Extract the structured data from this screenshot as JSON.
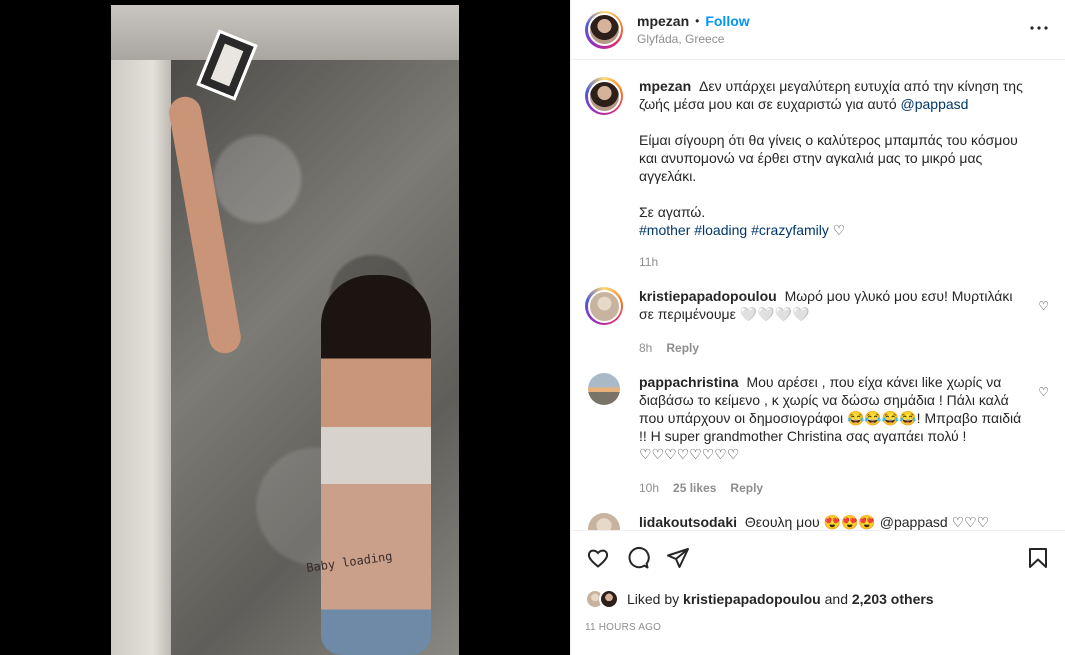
{
  "post": {
    "author": "mpezan",
    "separator": "•",
    "follow_label": "Follow",
    "location": "Glyfáda, Greece",
    "more": "•••"
  },
  "photo": {
    "tattoo_text": "Baby loading"
  },
  "caption": {
    "username": "mpezan",
    "line1": "Δεν υπάρχει μεγαλύτερη ευτυχία από την κίνηση της ζωής μέσα μου και σε ευχαριστώ για αυτό",
    "mention": "@pappasd",
    "para2": "Είμαι σίγουρη ότι θα γίνεις ο καλύτερος μπαμπάς του κόσμου και ανυπομονώ να έρθει στην αγκαλιά μας το μικρό μας αγγελάκι.",
    "para3": "Σε αγαπώ.",
    "tags": [
      "#mother",
      "#loading",
      "#crazyfamily"
    ],
    "heart": "♡",
    "time": "11h"
  },
  "comments": [
    {
      "username": "kristiepapadopoulou",
      "text": "Μωρό μου γλυκό μου εσυ! Μυρτιλάκι σε περιμένουμε 🤍🤍🤍🤍",
      "time": "8h",
      "likes": "",
      "reply": "Reply",
      "heart": "♡"
    },
    {
      "username": "pappachristina",
      "text": "Μου αρέσει , που είχα κάνει like χωρίς να διαβάσω το κείμενο , κ χωρίς να δώσω σημάδια ! Πάλι καλά που υπάρχουν οι δημοσιογράφοι 😂😂😂😂! Μπραβο παιδιά !! Η super grandmother Christina σας αγαπάει πολύ ! ♡♡♡♡♡♡♡♡",
      "time": "10h",
      "likes": "25 likes",
      "reply": "Reply",
      "heart": "♡"
    },
    {
      "username": "lidakoutsodaki",
      "text": "Θεουλη μου 😍😍😍 @pappasd ♡♡♡",
      "time": "",
      "likes": "",
      "reply": "",
      "heart": ""
    }
  ],
  "footer": {
    "liked_by_prefix": "Liked by",
    "liked_by_user": "kristiepapadopoulou",
    "and": "and",
    "others": "2,203 others",
    "time_ago": "11 HOURS AGO"
  },
  "icons": {
    "like": "heart-icon",
    "comment": "comment-icon",
    "share": "share-icon",
    "save": "bookmark-icon",
    "more": "more-icon"
  }
}
